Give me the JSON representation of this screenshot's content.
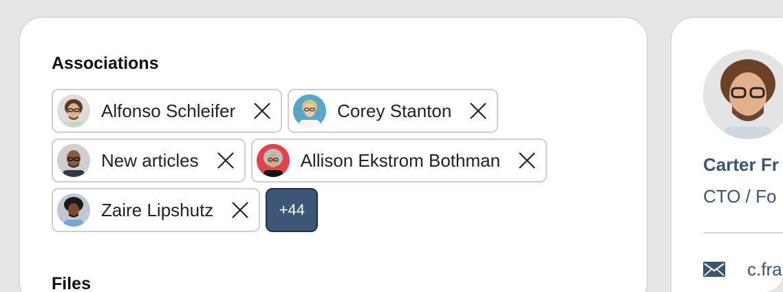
{
  "associations": {
    "title": "Associations",
    "chips": [
      {
        "name": "Alfonso Schleifer",
        "avatar": "avatar-curly-hair-glasses"
      },
      {
        "name": "Corey Stanton",
        "avatar": "avatar-blonde-glasses"
      },
      {
        "name": "New articles",
        "avatar": "avatar-bald-beard"
      },
      {
        "name": "Allison Ekstrom Bothman",
        "avatar": "avatar-gray-curly-red-bg"
      },
      {
        "name": "Zaire Lipshutz",
        "avatar": "avatar-curly-afro"
      }
    ],
    "more_label": "+44"
  },
  "files": {
    "title": "Files"
  },
  "profile": {
    "name": "Carter Fr",
    "role": "CTO / Fo",
    "email": "c.fra"
  },
  "colors": {
    "accent": "#3c5775",
    "profile_text": "#3b5470",
    "chip_border": "#cfcfcf"
  }
}
